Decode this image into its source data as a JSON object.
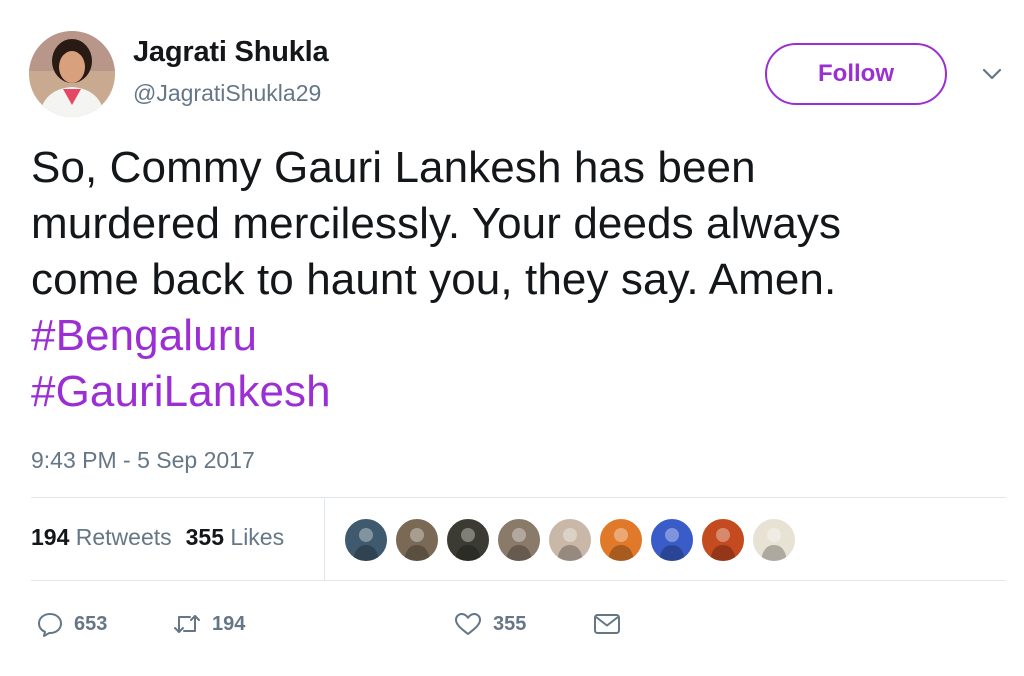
{
  "user": {
    "display_name": "Jagrati Shukla",
    "handle": "@JagratiShukla29",
    "avatar_icon": "profile-photo"
  },
  "follow_button": {
    "label": "Follow",
    "color": "#9b2fd4"
  },
  "more_menu_icon": "chevron-down-icon",
  "tweet": {
    "lines": [
      "So, Commy Gauri Lankesh has been",
      "murdered mercilessly. Your deeds always",
      "come back to haunt you, they say. Amen."
    ],
    "hashtags": [
      "#Bengaluru",
      "#GauriLankesh"
    ],
    "timestamp": "9:43 PM - 5 Sep 2017"
  },
  "stats": {
    "retweets_count": "194",
    "retweets_label": "Retweets",
    "likes_count": "355",
    "likes_label": "Likes"
  },
  "likers": [
    {
      "name": "liker-avatar-1",
      "color": "#3f5a6e"
    },
    {
      "name": "liker-avatar-2",
      "color": "#7a6a55"
    },
    {
      "name": "liker-avatar-3",
      "color": "#3b3b33"
    },
    {
      "name": "liker-avatar-4",
      "color": "#8a7a6a"
    },
    {
      "name": "liker-avatar-5",
      "color": "#c9b8a8"
    },
    {
      "name": "liker-avatar-6",
      "color": "#e07a2a"
    },
    {
      "name": "liker-avatar-7",
      "color": "#3a5cc8"
    },
    {
      "name": "liker-avatar-8",
      "color": "#c44a20"
    },
    {
      "name": "liker-avatar-9",
      "color": "#e8e2d4"
    }
  ],
  "actions": {
    "replies": "653",
    "retweets": "194",
    "likes": "355"
  },
  "colors": {
    "accent": "#9b2fd4",
    "text": "#14171a",
    "muted": "#657786",
    "divider": "#e1e8ed"
  }
}
